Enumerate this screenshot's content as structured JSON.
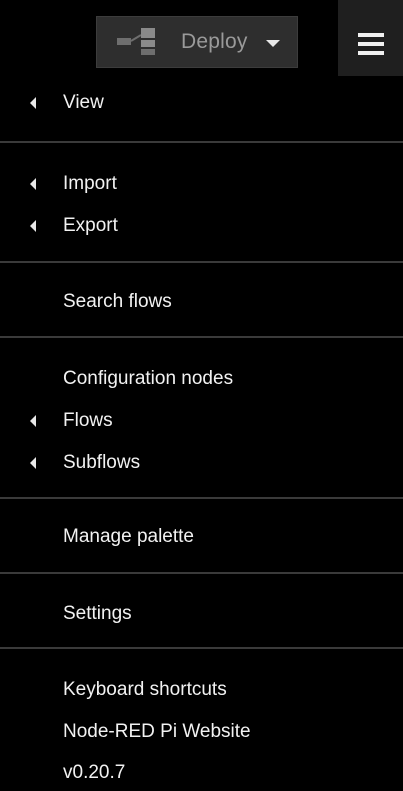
{
  "toolbar": {
    "deploy_label": "Deploy",
    "deploy_icon": "deploy-flow-icon",
    "menu_icon": "hamburger-icon"
  },
  "menu": {
    "items": [
      {
        "label": "View",
        "has_submenu": true
      },
      {
        "label": "Import",
        "has_submenu": true
      },
      {
        "label": "Export",
        "has_submenu": true
      },
      {
        "label": "Search flows",
        "has_submenu": false
      },
      {
        "label": "Configuration nodes",
        "has_submenu": false
      },
      {
        "label": "Flows",
        "has_submenu": true
      },
      {
        "label": "Subflows",
        "has_submenu": true
      },
      {
        "label": "Manage palette",
        "has_submenu": false
      },
      {
        "label": "Settings",
        "has_submenu": false
      },
      {
        "label": "Keyboard shortcuts",
        "has_submenu": false
      },
      {
        "label": "Node-RED Pi Website",
        "has_submenu": false
      }
    ],
    "version": "v0.20.7"
  },
  "colors": {
    "background": "#000000",
    "text": "#f2f2f2",
    "deploy_button": "#2e2e2e",
    "deploy_text": "#9a9a9a",
    "divider": "#3a3a3a"
  }
}
